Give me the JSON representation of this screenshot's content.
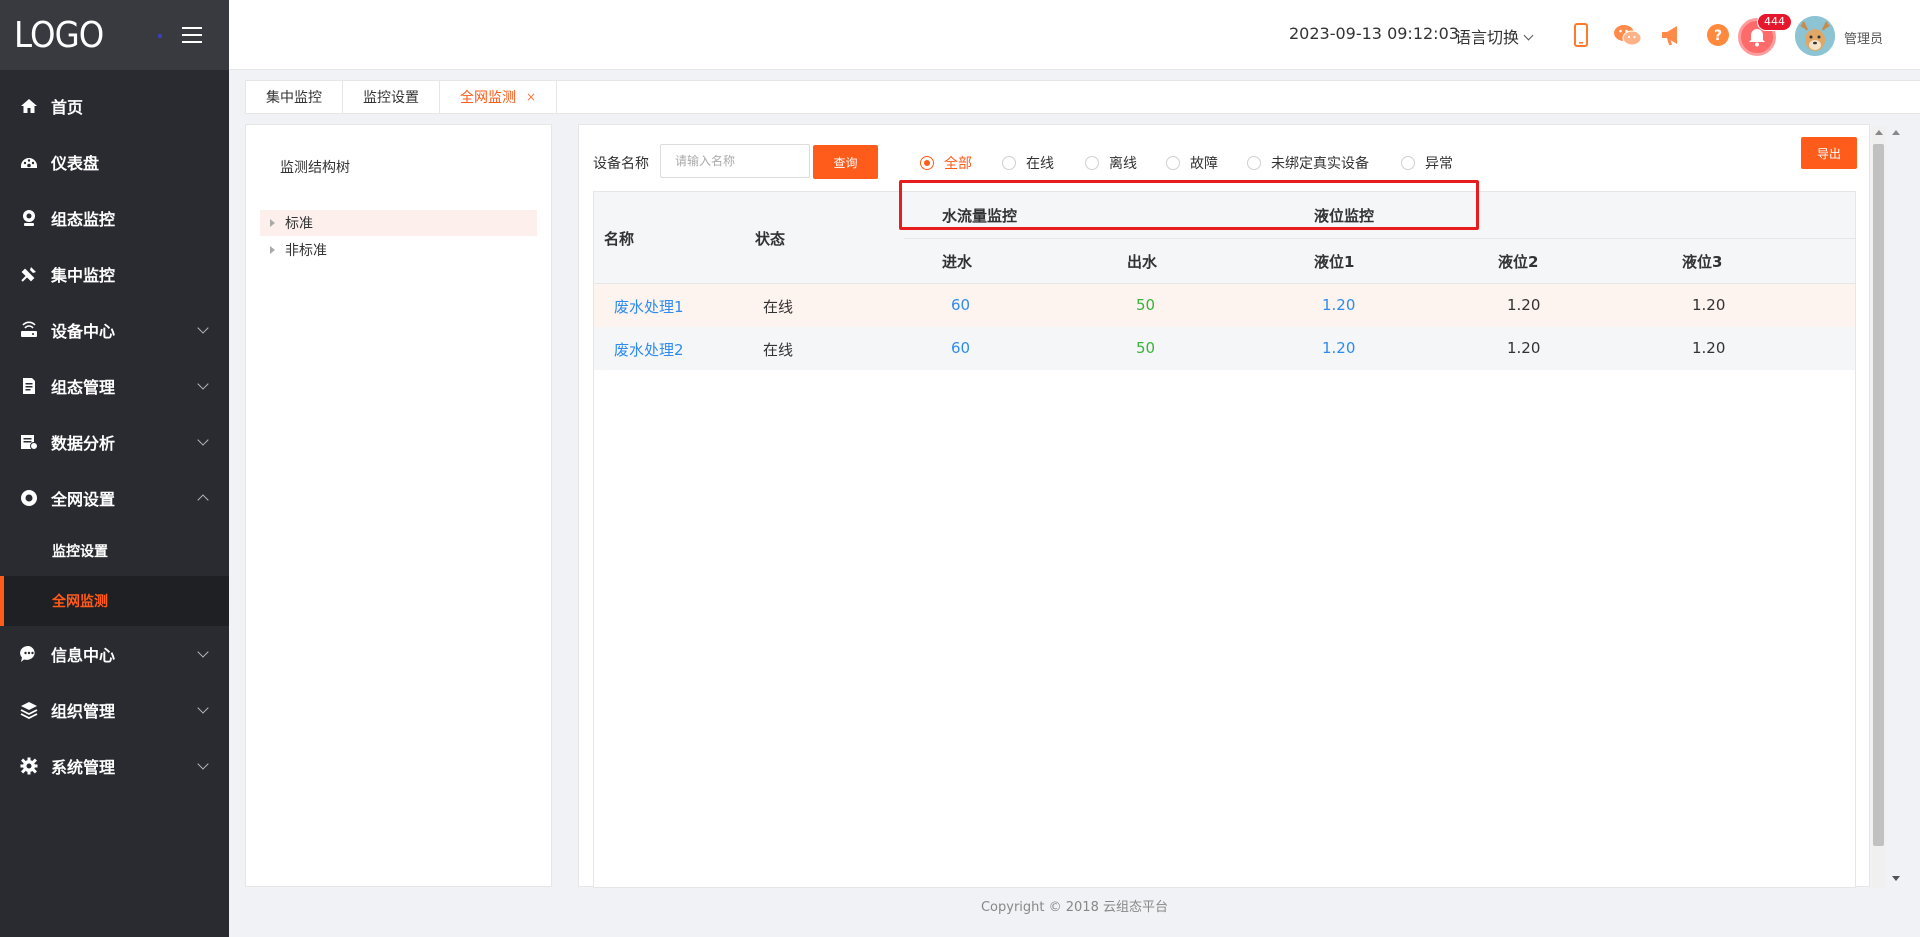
{
  "sidebar": {
    "logo": "LOGO",
    "menu": [
      {
        "label": "首页",
        "icon": "home-icon"
      },
      {
        "label": "仪表盘",
        "icon": "dashboard-icon"
      },
      {
        "label": "组态监控",
        "icon": "webcam-icon"
      },
      {
        "label": "集中监控",
        "icon": "satellite-icon"
      },
      {
        "label": "设备中心",
        "icon": "router-icon"
      },
      {
        "label": "组态管理",
        "icon": "document-icon"
      },
      {
        "label": "数据分析",
        "icon": "report-icon"
      },
      {
        "label": "全网设置",
        "icon": "network-icon"
      },
      {
        "label": "信息中心",
        "icon": "chat-icon"
      },
      {
        "label": "组织管理",
        "icon": "layers-icon"
      },
      {
        "label": "系统管理",
        "icon": "gear-icon"
      }
    ],
    "submenu": [
      {
        "label": "监控设置"
      },
      {
        "label": "全网监测"
      }
    ]
  },
  "header": {
    "datetime": "2023-09-13 09:12:03",
    "language": "语言切换",
    "badge_count": "444",
    "user": "管理员"
  },
  "tabs": [
    {
      "label": "集中监控"
    },
    {
      "label": "监控设置"
    },
    {
      "label": "全网监测",
      "close": "×"
    }
  ],
  "tree": {
    "title": "监测结构树",
    "nodes": [
      {
        "label": "标准"
      },
      {
        "label": "非标准"
      }
    ]
  },
  "filter": {
    "name_label": "设备名称",
    "search_placeholder": "请输入名称",
    "query_button": "查询",
    "export_button": "导出",
    "statuses": [
      {
        "label": "全部"
      },
      {
        "label": "在线"
      },
      {
        "label": "离线"
      },
      {
        "label": "故障"
      },
      {
        "label": "未绑定真实设备"
      },
      {
        "label": "异常"
      }
    ]
  },
  "table": {
    "col_name": "名称",
    "col_status": "状态",
    "group_flow": "水流量监控",
    "group_level": "液位监控",
    "sub_headers": [
      "进水",
      "出水",
      "液位1",
      "液位2",
      "液位3"
    ],
    "rows": [
      {
        "name": "废水处理1",
        "status": "在线",
        "inlet": "60",
        "outlet": "50",
        "level1": "1.20",
        "level2": "1.20",
        "level3": "1.20"
      },
      {
        "name": "废水处理2",
        "status": "在线",
        "inlet": "60",
        "outlet": "50",
        "level1": "1.20",
        "level2": "1.20",
        "level3": "1.20"
      }
    ]
  },
  "footer": "Copyright © 2018 云组态平台",
  "colors": {
    "accent": "#ff5b1a",
    "sidebar": "#2a2b30",
    "link": "#2d8cf0",
    "green": "#3bb23b",
    "highlight": "#e81c1c"
  }
}
